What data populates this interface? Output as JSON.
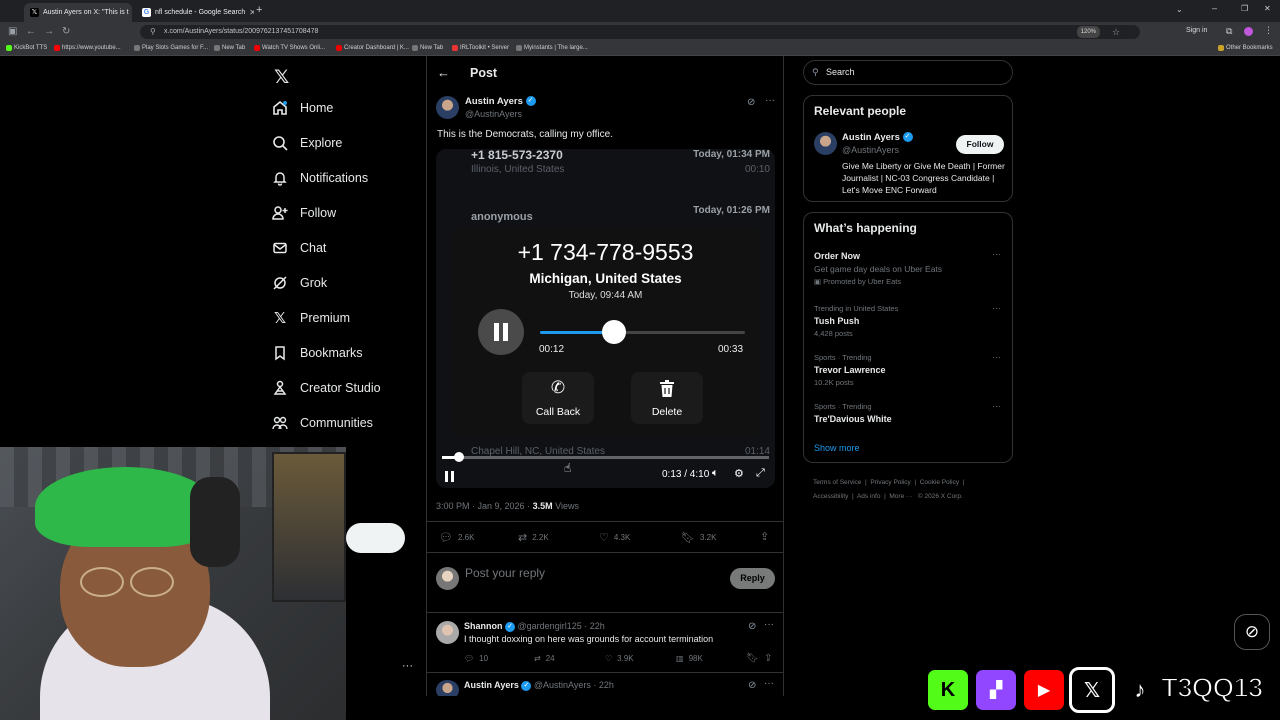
{
  "browser": {
    "tabs": [
      {
        "title": "Austin Ayers on X: \"This is t",
        "active": true
      },
      {
        "title": "nfl schedule - Google Search",
        "active": false
      }
    ],
    "url": "x.com/AustinAyers/status/2009762137451708478",
    "zoom": "120%",
    "sign_in": "Sign in",
    "bookmarks": [
      "KickBot TTS",
      "https://www.youtube...",
      "Play Slots Games for F...",
      "New Tab",
      "Watch TV Shows Onli...",
      "Creator Dashboard | K...",
      "New Tab",
      "IRLToolkit • Server",
      "Myinstants | The large..."
    ],
    "other_bookmarks": "Other Bookmarks"
  },
  "nav": {
    "logo": "𝕏",
    "items": [
      {
        "label": "Home",
        "icon": "home-icon"
      },
      {
        "label": "Explore",
        "icon": "search-icon"
      },
      {
        "label": "Notifications",
        "icon": "bell-icon"
      },
      {
        "label": "Follow",
        "icon": "follow-icon"
      },
      {
        "label": "Chat",
        "icon": "mail-icon"
      },
      {
        "label": "Grok",
        "icon": "grok-icon"
      },
      {
        "label": "Premium",
        "icon": "x-icon"
      },
      {
        "label": "Bookmarks",
        "icon": "bookmark-icon"
      },
      {
        "label": "Creator Studio",
        "icon": "creator-icon"
      },
      {
        "label": "Communities",
        "icon": "communities-icon"
      }
    ],
    "more": "···"
  },
  "post": {
    "header": "Post",
    "author": "Austin Ayers",
    "handle": "@AustinAyers",
    "text": "This is the Democrats, calling my office.",
    "timestamp": "3:00 PM · Jan 9, 2026 ·",
    "views_count": "3.5M",
    "views_label": "Views",
    "stats": {
      "replies": "2.6K",
      "reposts": "2.2K",
      "likes": "4.3K",
      "bookmarks": "3.2K"
    },
    "reply_placeholder": "Post your reply",
    "reply_button": "Reply"
  },
  "video": {
    "calls": [
      {
        "number": "+1 815-573-2370",
        "location": "Illinois, United States",
        "time": "Today, 01:34 PM",
        "duration": "00:10"
      },
      {
        "number": "anonymous",
        "location": "",
        "time": "Today, 01:26 PM",
        "duration": ""
      },
      {
        "number": "",
        "location": "Chapel Hill, NC, United States",
        "time": "",
        "duration": "01:14"
      }
    ],
    "active_call": {
      "number": "+1 734-778-9553",
      "location": "Michigan, United States",
      "time": "Today, 09:44 AM",
      "elapsed": "00:12",
      "total": "00:33",
      "progress": 0.36,
      "call_back": "Call Back",
      "delete": "Delete"
    },
    "player_time": "0:13 / 4:10",
    "player_progress": 0.052
  },
  "replies": [
    {
      "name": "Shannon",
      "handle": "@gardengirl125 · 22h",
      "text": "I thought doxxing on here was grounds for account termination",
      "stats": {
        "replies": "10",
        "reposts": "24",
        "likes": "3.9K",
        "views": "98K"
      }
    },
    {
      "name": "Austin Ayers",
      "handle": "@AustinAyers · 22h",
      "text": "",
      "stats": {}
    }
  ],
  "search": {
    "placeholder": "Search"
  },
  "relevant": {
    "title": "Relevant people",
    "name": "Austin Ayers",
    "handle": "@AustinAyers",
    "follow": "Follow",
    "bio": "Give Me Liberty or Give Me Death | Former Journalist | NC-03 Congress Candidate | Let's Move ENC Forward"
  },
  "happening": {
    "title": "What’s happening",
    "items": [
      {
        "context": "",
        "title": "Order Now",
        "sub": "Get game day deals on Uber Eats",
        "meta": "Promoted by Uber Eats"
      },
      {
        "context": "Trending in United States",
        "title": "Tush Push",
        "sub": "",
        "meta": "4,428 posts"
      },
      {
        "context": "Sports · Trending",
        "title": "Trevor Lawrence",
        "sub": "",
        "meta": "10.2K posts"
      },
      {
        "context": "Sports · Trending",
        "title": "Tre'Davious White",
        "sub": "",
        "meta": ""
      }
    ],
    "show_more": "Show more"
  },
  "footer": {
    "line1": [
      "Terms of Service",
      "Privacy Policy",
      "Cookie Policy"
    ],
    "line2": [
      "Accessibility",
      "Ads info",
      "More ···",
      "© 2026 X Corp."
    ]
  },
  "socials": {
    "handle": "T3QQ13"
  }
}
